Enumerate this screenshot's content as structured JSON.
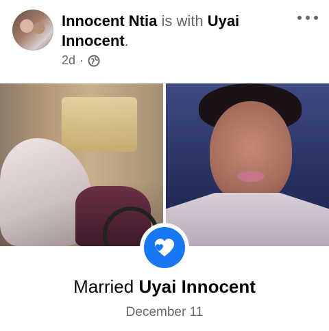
{
  "post": {
    "author": "Innocent Ntia",
    "connector": " is with ",
    "tagged": "Uyai Innocent",
    "period": ".",
    "time": "2d",
    "separator": "·",
    "privacy_icon": "globe-icon",
    "more_icon": "more-options-icon"
  },
  "life_event": {
    "icon": "heart-icon",
    "accent": "#1877f2",
    "prefix": "Married ",
    "name": "Uyai Innocent",
    "date": "December 11"
  }
}
